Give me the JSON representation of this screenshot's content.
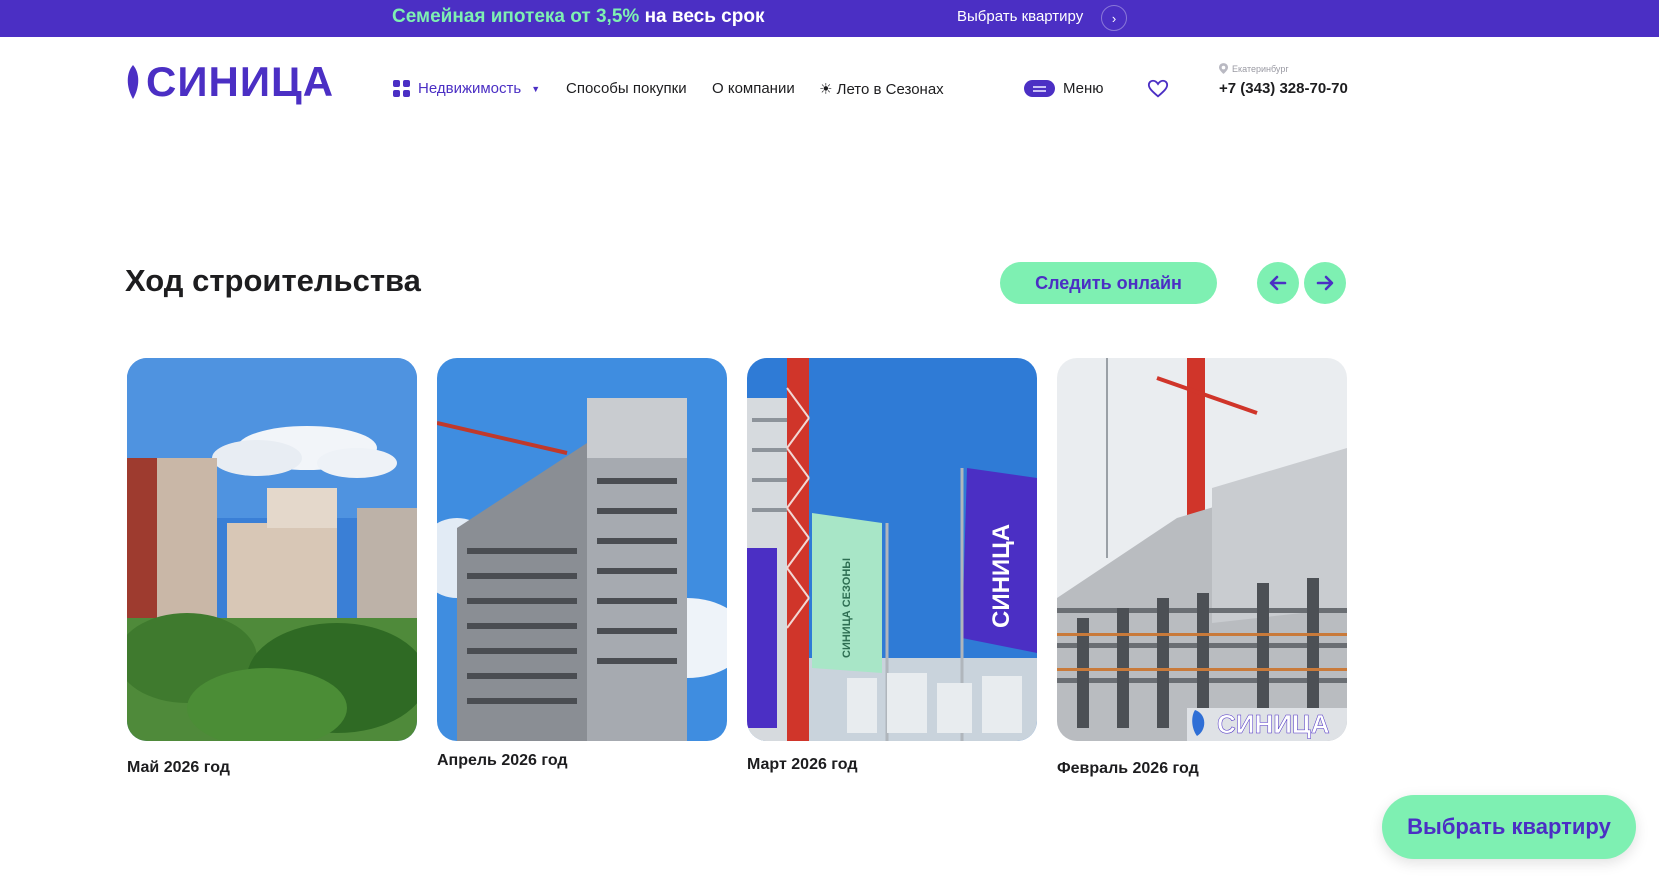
{
  "promo": {
    "text_accent": "Семейная ипотека от 3,5%",
    "text_rest": " на весь срок",
    "link_label": "Выбрать квартиру",
    "arrow_glyph": "›"
  },
  "header": {
    "logo_text": "СИНИЦА",
    "nav": {
      "realty": "Недвижимость",
      "ways": "Способы покупки",
      "about": "О компании",
      "summer": "☀ Лето в Сезонах"
    },
    "menu_label": "Меню",
    "city": "Екатеринбург",
    "phone": "+7 (343) 328-70-70"
  },
  "section": {
    "title": "Ход строительства",
    "watch_label": "Следить онлайн",
    "prev_icon": "arrow-left-icon",
    "next_icon": "arrow-right-icon"
  },
  "cards": [
    {
      "label": "Май 2026 год"
    },
    {
      "label": "Апрель 2026 год"
    },
    {
      "label": "Март 2026 год",
      "flag_text": "СИНИЦА СЕЗОНЫ",
      "flag_text_2": "СИНИЦА"
    },
    {
      "label": "Февраль 2026 год",
      "sign_text": "СИНИЦА"
    }
  ],
  "floating": {
    "choose_label": "Выбрать квартиру"
  },
  "colors": {
    "brand": "#4b2fc4",
    "accent": "#7ef0b2",
    "text": "#1d1d1f"
  }
}
